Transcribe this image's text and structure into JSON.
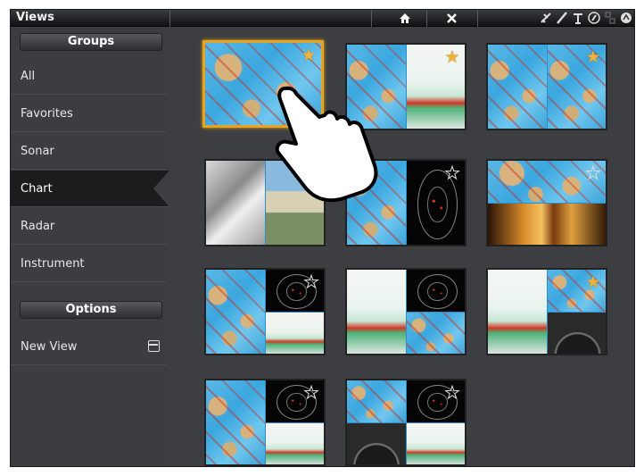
{
  "window": {
    "title": "Views"
  },
  "toolbar": {
    "home_icon": "home-icon",
    "close_icon": "close-icon"
  },
  "status_icons": [
    "gps-icon",
    "heading-icon",
    "antenna-icon",
    "compass-icon",
    "network-icon",
    "sonar-icon"
  ],
  "sidebar": {
    "groups_header": "Groups",
    "items": [
      {
        "label": "All"
      },
      {
        "label": "Favorites"
      },
      {
        "label": "Sonar"
      },
      {
        "label": "Chart",
        "selected": true
      },
      {
        "label": "Radar"
      },
      {
        "label": "Instrument"
      }
    ],
    "options_header": "Options",
    "options": [
      {
        "label": "New View",
        "icon": "new-view-icon"
      }
    ]
  },
  "views": [
    {
      "layout": "chart",
      "favorite": true,
      "selected": true
    },
    {
      "layout": "chart-sonar",
      "favorite": true
    },
    {
      "layout": "chart-chart",
      "favorite": true
    },
    {
      "layout": "3d-photo",
      "favorite": true
    },
    {
      "layout": "chart-radar",
      "favorite": false
    },
    {
      "layout": "chart-sidescan",
      "favorite": false
    },
    {
      "layout": "chart-radar-sonar",
      "favorite": false
    },
    {
      "layout": "sonar-radar-chart",
      "favorite": false
    },
    {
      "layout": "sonar-chart-gauge",
      "favorite": true
    },
    {
      "layout": "chart-radar-sonar",
      "favorite": false
    },
    {
      "layout": "chart-radar-gauge-sonar",
      "favorite": false
    }
  ],
  "colors": {
    "accent": "#e7a51f",
    "background": "#3c3e42",
    "selected": "#1b1c1e"
  }
}
